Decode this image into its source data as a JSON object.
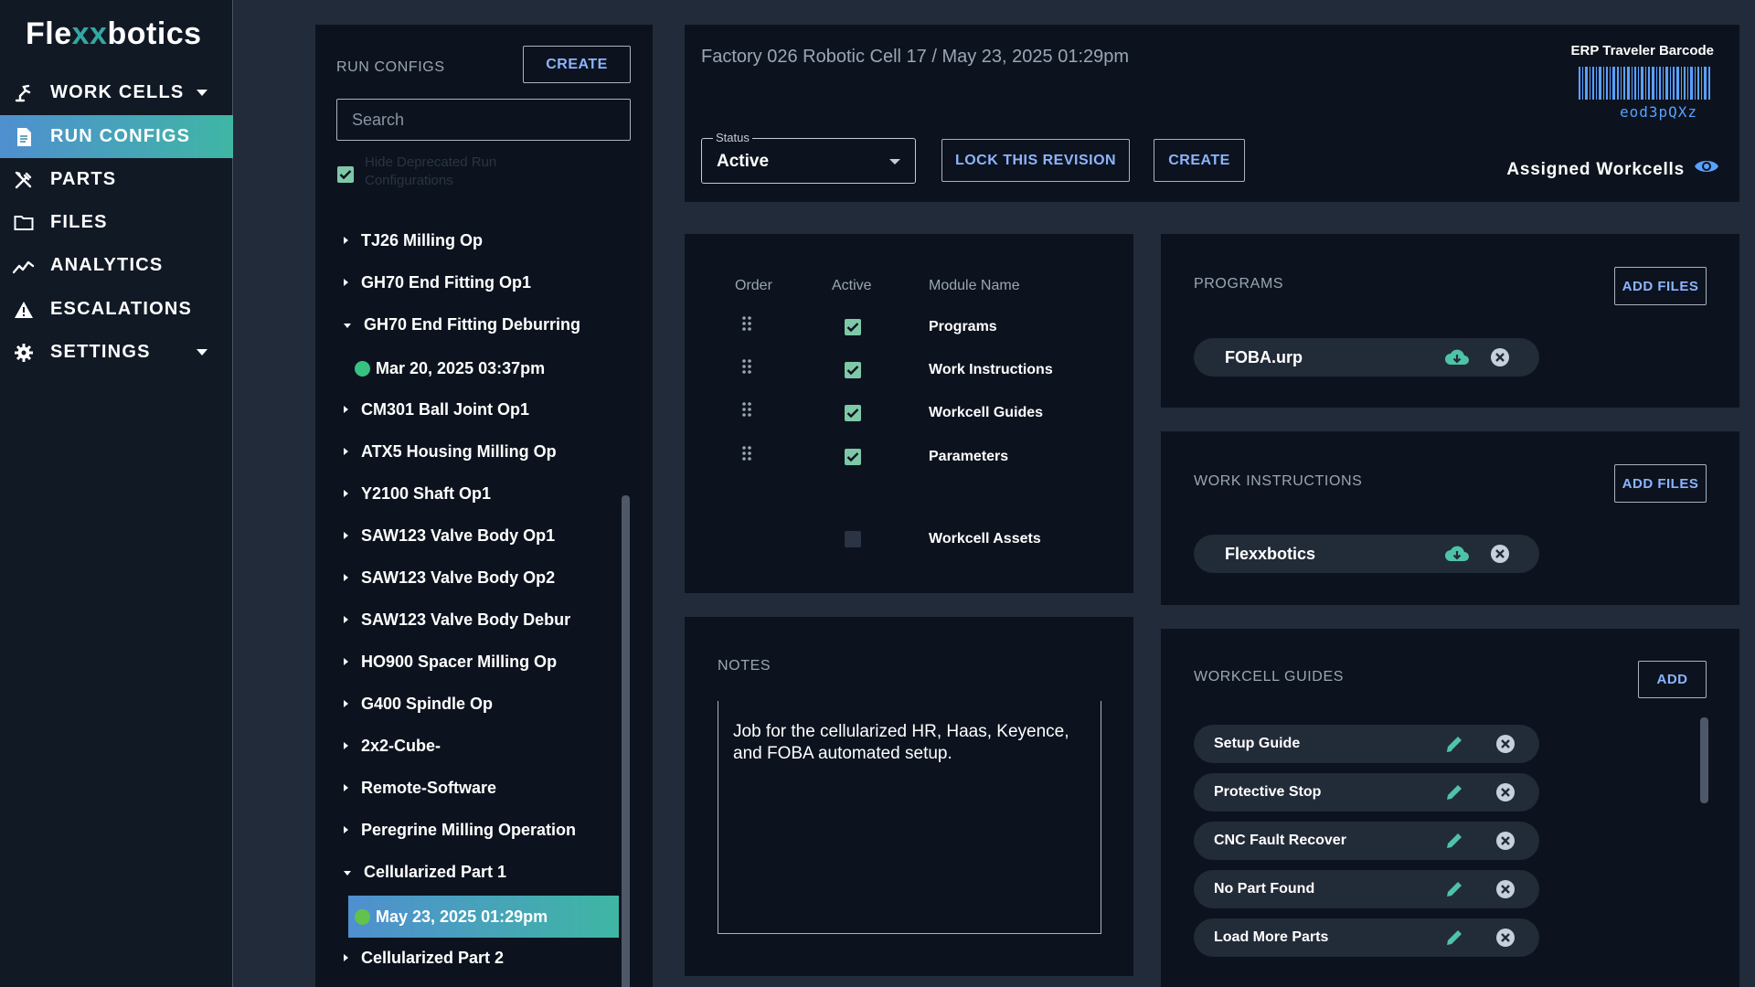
{
  "app": {
    "logo_prefix": "Fle",
    "logo_xx": "xx",
    "logo_suffix": "botics"
  },
  "sidebar": {
    "items": [
      {
        "label": "WORK CELLS",
        "icon": "robot-arm-icon"
      },
      {
        "label": "RUN CONFIGS",
        "icon": "document-icon"
      },
      {
        "label": "PARTS",
        "icon": "tools-icon"
      },
      {
        "label": "FILES",
        "icon": "folder-icon"
      },
      {
        "label": "ANALYTICS",
        "icon": "trend-icon"
      },
      {
        "label": "ESCALATIONS",
        "icon": "warning-icon"
      },
      {
        "label": "SETTINGS",
        "icon": "gear-icon"
      }
    ]
  },
  "run_configs": {
    "title": "RUN CONFIGS",
    "create_label": "CREATE",
    "search_placeholder": "Search",
    "show_deprecated_label": "Hide Deprecated Run Configurations",
    "items": [
      "TJ26 Milling Op",
      "GH70 End Fitting Op1",
      "GH70 End Fitting Deburring",
      "CM301 Ball Joint Op1",
      "ATX5 Housing Milling Op",
      "Y2100 Shaft Op1",
      "SAW123 Valve Body Op1",
      "SAW123 Valve Body Op2",
      "SAW123 Valve Body Debur",
      "HO900 Spacer Milling Op",
      "G400 Spindle Op",
      "2x2-Cube-",
      "Remote-Software",
      "Peregrine Milling Operation",
      "Cellularized Part 1",
      "Cellularized Part 2"
    ],
    "revisions": {
      "gh70_deburring": "Mar 20, 2025 03:37pm",
      "cellularized_part_1": "May 23, 2025 01:29pm"
    }
  },
  "header": {
    "breadcrumb": "Factory 026 Robotic Cell 17 / May 23, 2025 01:29pm",
    "status_label": "Status",
    "status_value": "Active",
    "lock_label": "LOCK THIS REVISION",
    "create_label": "CREATE",
    "barcode_title": "ERP Traveler Barcode",
    "barcode_code": "eod3pQXz",
    "assigned_label": "Assigned Workcells",
    "assigned_icon": "eye-icon"
  },
  "modules": {
    "col_order": "Order",
    "col_active": "Active",
    "col_name": "Module Name",
    "rows": [
      {
        "name": "Programs",
        "active": true
      },
      {
        "name": "Work Instructions",
        "active": true
      },
      {
        "name": "Workcell Guides",
        "active": true
      },
      {
        "name": "Parameters",
        "active": true
      },
      {
        "name": "Workcell Assets",
        "active": false
      }
    ]
  },
  "notes": {
    "title": "NOTES",
    "text": "Job for the cellularized HR, Haas, Keyence, and FOBA automated setup."
  },
  "programs": {
    "title": "PROGRAMS",
    "add_label": "ADD FILES",
    "files": [
      "FOBA.urp"
    ]
  },
  "work_instructions": {
    "title": "WORK INSTRUCTIONS",
    "add_label": "ADD FILES",
    "files": [
      "Flexxbotics"
    ]
  },
  "workcell_guides": {
    "title": "WORKCELL GUIDES",
    "add_label": "ADD",
    "items": [
      "Setup Guide",
      "Protective Stop",
      "CNC Fault Recover",
      "No Part Found",
      "Load More Parts"
    ]
  },
  "colors": {
    "accent_blue": "#4f8fd0",
    "accent_teal": "#3fb6a4",
    "check_green": "#7ec8a8",
    "link_blue": "#8cb4ff",
    "status_green": "#38c281"
  }
}
